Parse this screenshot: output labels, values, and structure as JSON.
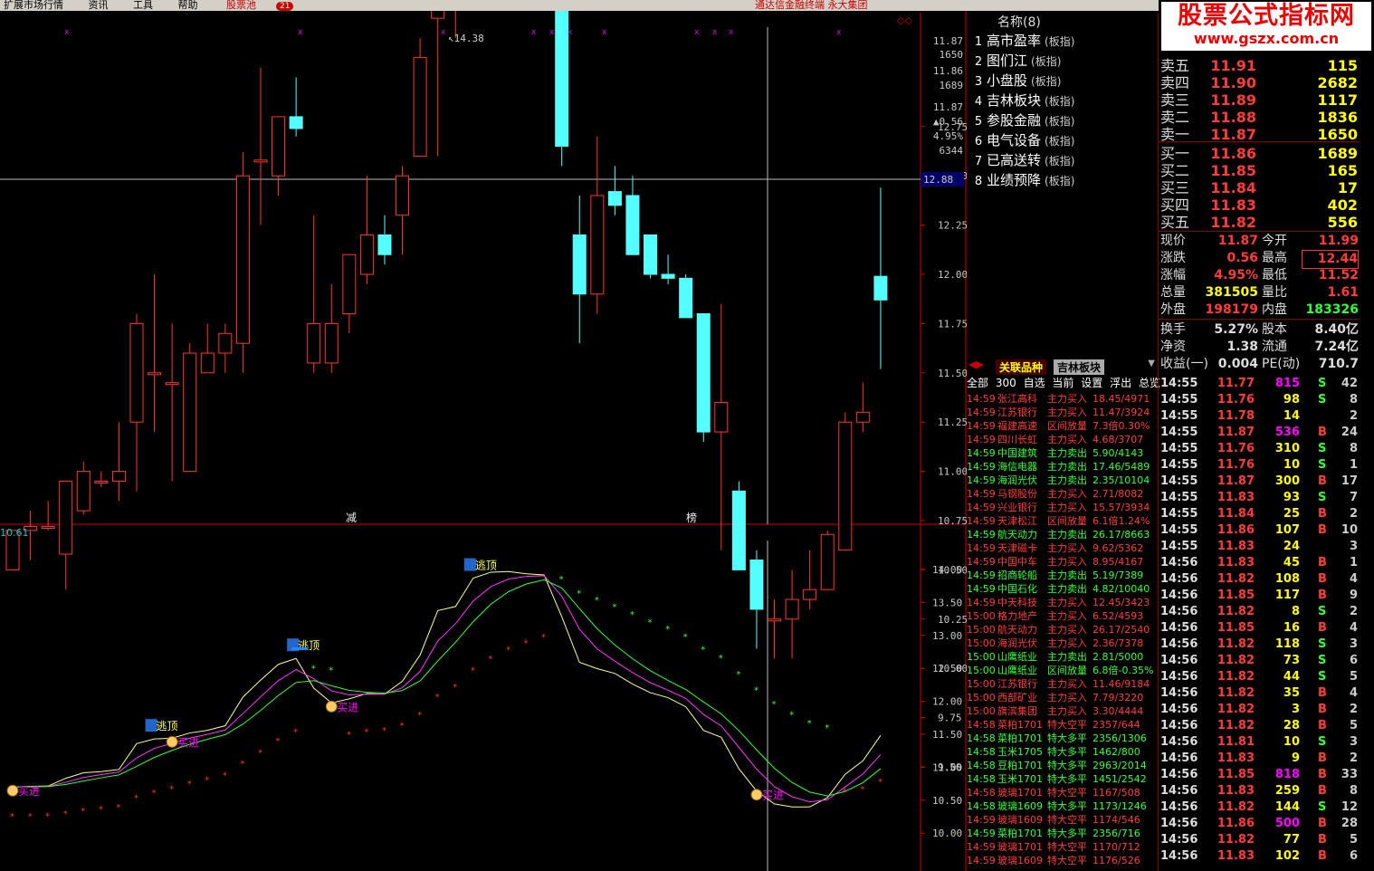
{
  "menu": {
    "items": [
      "扩展市场行情",
      "资讯",
      "工具",
      "帮助"
    ],
    "stock_pool": "股票池",
    "stock_pool_count": "21",
    "right_text": "通达信金融终端   永大集团"
  },
  "watermark": {
    "title": "股票公式指标网",
    "url": "www.gszx.com.cn"
  },
  "candle_chart": {
    "high_label": "14.38",
    "crosshair_value": "12.88",
    "bottom_markers": [
      "减",
      "榜"
    ],
    "price_axis": [
      "12.75",
      "12.50",
      "12.25",
      "12.00",
      "11.75",
      "11.50",
      "11.25",
      "11.00",
      "10.75",
      "10.50",
      "10.25",
      "10.00",
      "9.75",
      "9.50"
    ],
    "mini_quote": [
      "11.87",
      "1650",
      "11.86",
      "1689",
      "11.87",
      "▲0.56",
      "4.95%",
      "6344"
    ],
    "candles": [
      {
        "o": 10.5,
        "h": 10.7,
        "l": 10.5,
        "c": 10.7
      },
      {
        "o": 10.7,
        "h": 10.8,
        "l": 10.55,
        "c": 10.72
      },
      {
        "o": 10.72,
        "h": 10.85,
        "l": 10.7,
        "c": 10.72
      },
      {
        "o": 10.58,
        "h": 10.9,
        "l": 10.4,
        "c": 10.95
      },
      {
        "o": 10.8,
        "h": 11.05,
        "l": 10.78,
        "c": 11.0
      },
      {
        "o": 10.95,
        "h": 11.0,
        "l": 10.92,
        "c": 10.95
      },
      {
        "o": 10.95,
        "h": 11.25,
        "l": 10.85,
        "c": 11.0
      },
      {
        "o": 11.25,
        "h": 11.8,
        "l": 10.9,
        "c": 11.75
      },
      {
        "o": 11.5,
        "h": 12.0,
        "l": 11.2,
        "c": 11.5
      },
      {
        "o": 11.45,
        "h": 11.75,
        "l": 10.95,
        "c": 11.45
      },
      {
        "o": 11.0,
        "h": 11.65,
        "l": 11.0,
        "c": 11.6
      },
      {
        "o": 11.5,
        "h": 11.75,
        "l": 11.5,
        "c": 11.6
      },
      {
        "o": 11.6,
        "h": 11.75,
        "l": 11.5,
        "c": 11.7
      },
      {
        "o": 11.65,
        "h": 12.62,
        "l": 11.5,
        "c": 12.5
      },
      {
        "o": 12.58,
        "h": 13.05,
        "l": 12.25,
        "c": 12.58
      },
      {
        "o": 12.5,
        "h": 12.8,
        "l": 12.4,
        "c": 12.8
      },
      {
        "o": 12.8,
        "h": 13.0,
        "l": 12.7,
        "c": 12.74
      },
      {
        "o": 11.55,
        "h": 12.3,
        "l": 11.5,
        "c": 11.75
      },
      {
        "o": 11.55,
        "h": 11.95,
        "l": 11.5,
        "c": 11.75
      },
      {
        "o": 11.8,
        "h": 12.05,
        "l": 11.7,
        "c": 12.1
      },
      {
        "o": 12.0,
        "h": 12.5,
        "l": 11.95,
        "c": 12.2
      },
      {
        "o": 12.2,
        "h": 12.3,
        "l": 12.05,
        "c": 12.1
      },
      {
        "o": 12.3,
        "h": 12.55,
        "l": 12.1,
        "c": 12.5
      },
      {
        "o": 12.6,
        "h": 13.2,
        "l": 12.6,
        "c": 13.1
      },
      {
        "o": 13.3,
        "h": 14.1,
        "l": 12.6,
        "c": 14.05
      },
      {
        "o": 13.4,
        "h": 13.5,
        "l": 13.2,
        "c": 13.5
      },
      {
        "o": 13.9,
        "h": 14.5,
        "l": 13.6,
        "c": 14.3
      },
      {
        "o": 14.28,
        "h": 14.38,
        "l": 13.9,
        "c": 14.05
      },
      {
        "o": 14.1,
        "h": 14.2,
        "l": 13.85,
        "c": 13.98
      },
      {
        "o": 14.0,
        "h": 14.1,
        "l": 13.85,
        "c": 13.9
      },
      {
        "o": 13.9,
        "h": 14.0,
        "l": 13.6,
        "c": 13.9
      },
      {
        "o": 14.0,
        "h": 14.6,
        "l": 12.55,
        "c": 12.65
      },
      {
        "o": 12.2,
        "h": 12.4,
        "l": 11.65,
        "c": 11.9
      },
      {
        "o": 11.9,
        "h": 12.7,
        "l": 11.8,
        "c": 12.4
      },
      {
        "o": 12.42,
        "h": 12.55,
        "l": 12.3,
        "c": 12.35
      },
      {
        "o": 12.4,
        "h": 12.5,
        "l": 12.1,
        "c": 12.1
      },
      {
        "o": 12.2,
        "h": 12.2,
        "l": 11.98,
        "c": 12.0
      },
      {
        "o": 12.0,
        "h": 12.1,
        "l": 11.95,
        "c": 11.98
      },
      {
        "o": 11.98,
        "h": 12.0,
        "l": 11.8,
        "c": 11.78
      },
      {
        "o": 11.8,
        "h": 11.8,
        "l": 11.15,
        "c": 11.2
      },
      {
        "o": 11.2,
        "h": 11.85,
        "l": 10.6,
        "c": 11.35
      },
      {
        "o": 10.9,
        "h": 10.95,
        "l": 10.5,
        "c": 10.5
      },
      {
        "o": 10.55,
        "h": 10.6,
        "l": 10.1,
        "c": 10.3
      },
      {
        "o": 10.25,
        "h": 10.35,
        "l": 10.05,
        "c": 10.25
      },
      {
        "o": 10.25,
        "h": 10.5,
        "l": 10.05,
        "c": 10.35
      },
      {
        "o": 10.35,
        "h": 10.6,
        "l": 10.3,
        "c": 10.4
      },
      {
        "o": 10.4,
        "h": 10.7,
        "l": 10.4,
        "c": 10.68
      },
      {
        "o": 10.6,
        "h": 11.3,
        "l": 10.6,
        "c": 11.25
      },
      {
        "o": 11.25,
        "h": 11.45,
        "l": 11.2,
        "c": 11.3
      },
      {
        "o": 11.99,
        "h": 12.44,
        "l": 11.52,
        "c": 11.87
      }
    ]
  },
  "indicator": {
    "value_label": "10.61",
    "axis": [
      "14.00",
      "13.50",
      "13.00",
      "12.50",
      "12.00",
      "11.50",
      "11.00",
      "10.50",
      "10.00"
    ],
    "signals": [
      {
        "text": "买进",
        "k": 0
      },
      {
        "text": "逃顶",
        "k": 8
      },
      {
        "text": "买进",
        "k": 9
      },
      {
        "text": "逃顶",
        "k": 16
      },
      {
        "text": "买进",
        "k": 18
      },
      {
        "text": "逃顶",
        "k": 26
      },
      {
        "text": "买进",
        "k": 42
      }
    ]
  },
  "sectors": {
    "header": "名称(8)",
    "items": [
      {
        "no": "1",
        "name": "高市盈率",
        "type": "(板指)"
      },
      {
        "no": "2",
        "name": "图们江",
        "type": "(板指)"
      },
      {
        "no": "3",
        "name": "小盘股",
        "type": "(板指)"
      },
      {
        "no": "4",
        "name": "吉林板块",
        "type": "(板指)"
      },
      {
        "no": "5",
        "name": "参股金融",
        "type": "(板指)"
      },
      {
        "no": "6",
        "name": "电气设备",
        "type": "(板指)"
      },
      {
        "no": "7",
        "name": "已高送转",
        "type": "(板指)"
      },
      {
        "no": "8",
        "name": "业绩预降",
        "type": "(板指)"
      }
    ]
  },
  "tabs": {
    "related": "关联品种",
    "sector": "吉林板块",
    "sub": [
      "全部",
      "300",
      "自选",
      "当前",
      "设置",
      "浮出",
      "总览"
    ]
  },
  "alerts": [
    {
      "t": "14:59",
      "n": "张江高科",
      "ty": "主力买入",
      "v": "18.45/4971",
      "c": "red"
    },
    {
      "t": "14:59",
      "n": "江苏银行",
      "ty": "主力买入",
      "v": "11.47/3924",
      "c": "red"
    },
    {
      "t": "14:59",
      "n": "福建高速",
      "ty": "区间放量",
      "v": "7.3倍0.30%",
      "c": "red"
    },
    {
      "t": "14:59",
      "n": "四川长虹",
      "ty": "主力买入",
      "v": "4.68/3707",
      "c": "red"
    },
    {
      "t": "14:59",
      "n": "中国建筑",
      "ty": "主力卖出",
      "v": "5.90/4143",
      "c": "green"
    },
    {
      "t": "14:59",
      "n": "海信电器",
      "ty": "主力卖出",
      "v": "17.46/5489",
      "c": "green"
    },
    {
      "t": "14:59",
      "n": "海润光伏",
      "ty": "主力卖出",
      "v": "2.35/10104",
      "c": "green"
    },
    {
      "t": "14:59",
      "n": "马钢股份",
      "ty": "主力买入",
      "v": "2.71/8082",
      "c": "red"
    },
    {
      "t": "14:59",
      "n": "兴业银行",
      "ty": "主力买入",
      "v": "15.57/3934",
      "c": "red"
    },
    {
      "t": "14:59",
      "n": "天津松江",
      "ty": "区间放量",
      "v": "6.1倍1.24%",
      "c": "red"
    },
    {
      "t": "14:59",
      "n": "航天动力",
      "ty": "主力卖出",
      "v": "26.17/8663",
      "c": "green"
    },
    {
      "t": "14:59",
      "n": "天津磁卡",
      "ty": "主力买入",
      "v": "9.62/5362",
      "c": "red"
    },
    {
      "t": "14:59",
      "n": "中国中车",
      "ty": "主力买入",
      "v": "8.95/4167",
      "c": "red"
    },
    {
      "t": "14:59",
      "n": "招商轮船",
      "ty": "主力卖出",
      "v": "5.19/7389",
      "c": "green"
    },
    {
      "t": "14:59",
      "n": "中国石化",
      "ty": "主力卖出",
      "v": "4.82/10040",
      "c": "green"
    },
    {
      "t": "14:59",
      "n": "中天科技",
      "ty": "主力买入",
      "v": "12.45/3423",
      "c": "red"
    },
    {
      "t": "15:00",
      "n": "格力地产",
      "ty": "主力买入",
      "v": "6.52/4593",
      "c": "red"
    },
    {
      "t": "15:00",
      "n": "航天动力",
      "ty": "主力买入",
      "v": "26.17/2540",
      "c": "red"
    },
    {
      "t": "15:00",
      "n": "海润光伏",
      "ty": "主力买入",
      "v": "2.36/7378",
      "c": "red"
    },
    {
      "t": "15:00",
      "n": "山鹰纸业",
      "ty": "主力卖出",
      "v": "2.81/5000",
      "c": "green"
    },
    {
      "t": "15:00",
      "n": "山鹰纸业",
      "ty": "区间放量",
      "v": "6.8倍-0.35%",
      "c": "green"
    },
    {
      "t": "15:00",
      "n": "江苏银行",
      "ty": "主力买入",
      "v": "11.46/9184",
      "c": "red"
    },
    {
      "t": "15:00",
      "n": "西部矿业",
      "ty": "主力买入",
      "v": "7.79/3220",
      "c": "red"
    },
    {
      "t": "15:00",
      "n": "旗滨集团",
      "ty": "主力买入",
      "v": "3.30/4444",
      "c": "red"
    },
    {
      "t": "14:58",
      "n": "菜粕1701",
      "ty": "特大空平",
      "v": "2357/644",
      "c": "red"
    },
    {
      "t": "14:58",
      "n": "菜粕1701",
      "ty": "特大多平",
      "v": "2356/1306",
      "c": "green"
    },
    {
      "t": "14:58",
      "n": "玉米1705",
      "ty": "特大多平",
      "v": "1462/800",
      "c": "green"
    },
    {
      "t": "14:58",
      "n": "豆粕1701",
      "ty": "特大多平",
      "v": "2963/2014",
      "c": "green"
    },
    {
      "t": "14:58",
      "n": "玉米1701",
      "ty": "特大多平",
      "v": "1451/2542",
      "c": "green"
    },
    {
      "t": "14:58",
      "n": "玻璃1701",
      "ty": "特大空平",
      "v": "1167/508",
      "c": "red"
    },
    {
      "t": "14:58",
      "n": "玻璃1609",
      "ty": "特大多平",
      "v": "1173/1246",
      "c": "green"
    },
    {
      "t": "14:59",
      "n": "玻璃1609",
      "ty": "特大空平",
      "v": "1174/546",
      "c": "red"
    },
    {
      "t": "14:59",
      "n": "菜粕1701",
      "ty": "特大多平",
      "v": "2356/716",
      "c": "green"
    },
    {
      "t": "14:59",
      "n": "玻璃1701",
      "ty": "特大空平",
      "v": "1170/712",
      "c": "red"
    },
    {
      "t": "14:59",
      "n": "玻璃1609",
      "ty": "特大空平",
      "v": "1176/526",
      "c": "red"
    }
  ],
  "order_book": {
    "sell": [
      {
        "lbl": "卖五",
        "px": "11.91",
        "vol": "115"
      },
      {
        "lbl": "卖四",
        "px": "11.90",
        "vol": "2682"
      },
      {
        "lbl": "卖三",
        "px": "11.89",
        "vol": "1117"
      },
      {
        "lbl": "卖二",
        "px": "11.88",
        "vol": "1836"
      },
      {
        "lbl": "卖一",
        "px": "11.87",
        "vol": "1650"
      }
    ],
    "buy": [
      {
        "lbl": "买一",
        "px": "11.86",
        "vol": "1689"
      },
      {
        "lbl": "买二",
        "px": "11.85",
        "vol": "165"
      },
      {
        "lbl": "买三",
        "px": "11.84",
        "vol": "17"
      },
      {
        "lbl": "买四",
        "px": "11.83",
        "vol": "402"
      },
      {
        "lbl": "买五",
        "px": "11.82",
        "vol": "556"
      }
    ]
  },
  "quote": [
    {
      "l1": "现价",
      "v1": "11.87",
      "c1": "red",
      "l2": "今开",
      "v2": "11.99",
      "c2": "red"
    },
    {
      "l1": "涨跌",
      "v1": "0.56",
      "c1": "red",
      "l2": "最高",
      "v2": "12.44",
      "c2": "red"
    },
    {
      "l1": "涨幅",
      "v1": "4.95%",
      "c1": "red",
      "l2": "最低",
      "v2": "11.52",
      "c2": "red"
    },
    {
      "l1": "总量",
      "v1": "381505",
      "c1": "yellow",
      "l2": "量比",
      "v2": "1.61",
      "c2": "red"
    },
    {
      "l1": "外盘",
      "v1": "198179",
      "c1": "red",
      "l2": "内盘",
      "v2": "183326",
      "c2": "green"
    },
    {
      "l1": "换手",
      "v1": "5.27%",
      "c1": "white",
      "l2": "股本",
      "v2": "8.40亿",
      "c2": "white"
    },
    {
      "l1": "净资",
      "v1": "1.38",
      "c1": "white",
      "l2": "流通",
      "v2": "7.24亿",
      "c2": "white"
    },
    {
      "l1": "收益(一)",
      "v1": "0.004",
      "c1": "white",
      "l2": "PE(动)",
      "v2": "710.7",
      "c2": "white"
    }
  ],
  "ticks": [
    {
      "t": "14:55",
      "p": "11.77",
      "pc": "red",
      "v": "815",
      "vc": "mag",
      "s": "S",
      "n": "42"
    },
    {
      "t": "14:55",
      "p": "11.76",
      "pc": "red",
      "v": "98",
      "vc": "yellow",
      "s": "S",
      "n": "8"
    },
    {
      "t": "14:55",
      "p": "11.78",
      "pc": "red",
      "v": "14",
      "vc": "yellow",
      "s": "",
      "n": "2"
    },
    {
      "t": "14:55",
      "p": "11.87",
      "pc": "red",
      "v": "536",
      "vc": "mag",
      "s": "B",
      "n": "24"
    },
    {
      "t": "14:55",
      "p": "11.76",
      "pc": "red",
      "v": "310",
      "vc": "yellow",
      "s": "S",
      "n": "8"
    },
    {
      "t": "14:55",
      "p": "11.76",
      "pc": "red",
      "v": "10",
      "vc": "yellow",
      "s": "S",
      "n": "1"
    },
    {
      "t": "14:55",
      "p": "11.87",
      "pc": "red",
      "v": "300",
      "vc": "yellow",
      "s": "B",
      "n": "17"
    },
    {
      "t": "14:55",
      "p": "11.83",
      "pc": "red",
      "v": "93",
      "vc": "yellow",
      "s": "S",
      "n": "7"
    },
    {
      "t": "14:55",
      "p": "11.84",
      "pc": "red",
      "v": "25",
      "vc": "yellow",
      "s": "B",
      "n": "2"
    },
    {
      "t": "14:55",
      "p": "11.86",
      "pc": "red",
      "v": "107",
      "vc": "yellow",
      "s": "B",
      "n": "10"
    },
    {
      "t": "14:55",
      "p": "11.83",
      "pc": "red",
      "v": "24",
      "vc": "yellow",
      "s": "",
      "n": "3"
    },
    {
      "t": "14:56",
      "p": "11.83",
      "pc": "red",
      "v": "45",
      "vc": "yellow",
      "s": "B",
      "n": "1"
    },
    {
      "t": "14:56",
      "p": "11.82",
      "pc": "red",
      "v": "108",
      "vc": "yellow",
      "s": "B",
      "n": "4"
    },
    {
      "t": "14:56",
      "p": "11.85",
      "pc": "red",
      "v": "117",
      "vc": "yellow",
      "s": "B",
      "n": "9"
    },
    {
      "t": "14:56",
      "p": "11.82",
      "pc": "red",
      "v": "8",
      "vc": "yellow",
      "s": "S",
      "n": "2"
    },
    {
      "t": "14:56",
      "p": "11.85",
      "pc": "red",
      "v": "16",
      "vc": "yellow",
      "s": "B",
      "n": "4"
    },
    {
      "t": "14:56",
      "p": "11.82",
      "pc": "red",
      "v": "118",
      "vc": "yellow",
      "s": "S",
      "n": "3"
    },
    {
      "t": "14:56",
      "p": "11.82",
      "pc": "red",
      "v": "73",
      "vc": "yellow",
      "s": "S",
      "n": "6"
    },
    {
      "t": "14:56",
      "p": "11.82",
      "pc": "red",
      "v": "44",
      "vc": "yellow",
      "s": "S",
      "n": "5"
    },
    {
      "t": "14:56",
      "p": "11.82",
      "pc": "red",
      "v": "35",
      "vc": "yellow",
      "s": "B",
      "n": "4"
    },
    {
      "t": "14:56",
      "p": "11.82",
      "pc": "red",
      "v": "3",
      "vc": "yellow",
      "s": "B",
      "n": "2"
    },
    {
      "t": "14:56",
      "p": "11.82",
      "pc": "red",
      "v": "28",
      "vc": "yellow",
      "s": "B",
      "n": "5"
    },
    {
      "t": "14:56",
      "p": "11.81",
      "pc": "red",
      "v": "10",
      "vc": "yellow",
      "s": "S",
      "n": "3"
    },
    {
      "t": "14:56",
      "p": "11.83",
      "pc": "red",
      "v": "9",
      "vc": "yellow",
      "s": "B",
      "n": "2"
    },
    {
      "t": "14:56",
      "p": "11.85",
      "pc": "red",
      "v": "818",
      "vc": "mag",
      "s": "B",
      "n": "33"
    },
    {
      "t": "14:56",
      "p": "11.83",
      "pc": "red",
      "v": "259",
      "vc": "yellow",
      "s": "B",
      "n": "8"
    },
    {
      "t": "14:56",
      "p": "11.82",
      "pc": "red",
      "v": "144",
      "vc": "yellow",
      "s": "S",
      "n": "12"
    },
    {
      "t": "14:56",
      "p": "11.86",
      "pc": "red",
      "v": "500",
      "vc": "mag",
      "s": "B",
      "n": "28"
    },
    {
      "t": "14:56",
      "p": "11.82",
      "pc": "red",
      "v": "77",
      "vc": "yellow",
      "s": "B",
      "n": "5"
    },
    {
      "t": "14:56",
      "p": "11.83",
      "pc": "red",
      "v": "102",
      "vc": "yellow",
      "s": "B",
      "n": "6"
    }
  ]
}
